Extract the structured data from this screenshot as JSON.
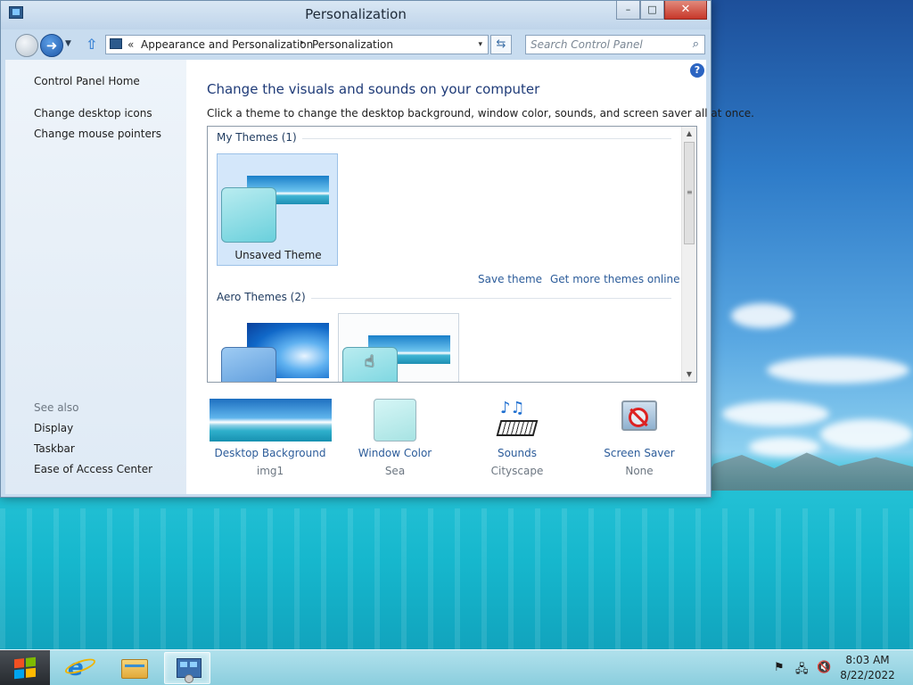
{
  "window": {
    "title": "Personalization",
    "controls": {
      "minimize": "–",
      "maximize": "□",
      "close": "✕"
    }
  },
  "address_bar": {
    "chevron": "«",
    "crumbs": [
      "Appearance and Personalization",
      "Personalization"
    ],
    "separator": "▸",
    "dropdown": "▾",
    "refresh": "⇆"
  },
  "search": {
    "placeholder": "Search Control Panel",
    "icon": "search-icon"
  },
  "sidebar": {
    "home_link": "Control Panel Home",
    "links": [
      "Change desktop icons",
      "Change mouse pointers"
    ],
    "see_also_title": "See also",
    "see_also": [
      "Display",
      "Taskbar",
      "Ease of Access Center"
    ]
  },
  "main": {
    "help": "?",
    "heading": "Change the visuals and sounds on your computer",
    "description": "Click a theme to change the desktop background, window color, sounds, and screen saver all at once.",
    "my_themes": {
      "title": "My Themes (1)",
      "items": [
        {
          "name": "Unsaved Theme",
          "selected": true
        }
      ],
      "actions": {
        "save": "Save theme",
        "more": "Get more themes online"
      }
    },
    "aero_themes": {
      "title": "Aero Themes (2)"
    }
  },
  "settings": [
    {
      "label": "Desktop Background",
      "value": "img1",
      "icon": "desktop-background-thumbnail"
    },
    {
      "label": "Window Color",
      "value": "Sea",
      "icon": "window-color-swatch",
      "color": "#bfeeee"
    },
    {
      "label": "Sounds",
      "value": "Cityscape",
      "icon": "sounds-icon"
    },
    {
      "label": "Screen Saver",
      "value": "None",
      "icon": "screen-saver-icon"
    }
  ],
  "taskbar": {
    "pinned": [
      "start-button",
      "internet-explorer-icon",
      "file-explorer-icon",
      "control-panel-icon"
    ],
    "clock": {
      "time": "8:03 AM",
      "date": "8/22/2022"
    },
    "tray_icons": [
      "action-center-flag-icon",
      "network-icon",
      "volume-muted-icon"
    ]
  },
  "colors": {
    "heading_blue": "#1f3b78",
    "link_blue": "#2c5c9a",
    "selection": "#d4e7fa"
  }
}
